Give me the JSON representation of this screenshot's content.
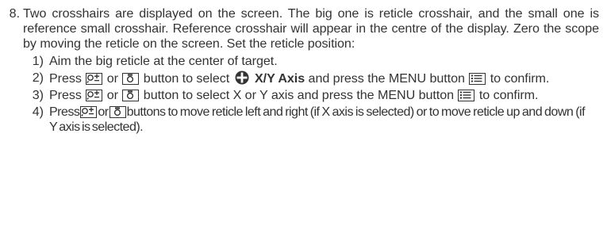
{
  "step": {
    "number": "8.",
    "text": "Two crosshairs are displayed on the screen. The big one is reticle crosshair, and the small one is reference small crosshair. Reference crosshair will appear in the centre of the display. Zero the scope by moving the reticle on the screen. Set the reticle position:"
  },
  "substeps": [
    {
      "number": "1)",
      "text": "Aim the big reticle at the center of target."
    },
    {
      "number": "2)",
      "prefix": "Press",
      "or": "or",
      "middle": "button to select",
      "bold": "X/Y Axis",
      "middle2": "and press the MENU button",
      "suffix": "to confirm."
    },
    {
      "number": "3)",
      "prefix": "Press",
      "or": "or",
      "middle": "button to select X or Y axis and press the MENU button",
      "suffix": "to confirm."
    },
    {
      "number": "4)",
      "prefix": "Press",
      "or": "or",
      "middle": "buttons to move reticle left and right (if X axis is selected) or to move reticle up and down (if Y axis is selected)."
    }
  ],
  "icons": {
    "zoom": "zoom-plus-minus-icon",
    "camera": "camera-icon",
    "menu": "menu-list-icon",
    "crosshair": "crosshair-icon"
  },
  "colors": {
    "text": "#333333"
  }
}
